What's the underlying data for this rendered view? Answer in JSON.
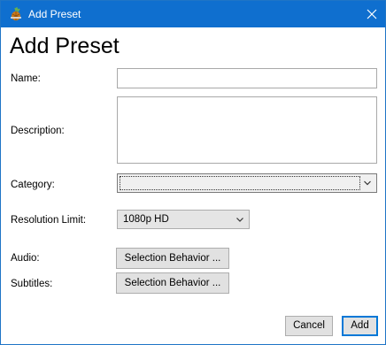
{
  "window": {
    "title": "Add Preset",
    "icons": {
      "app": "handbrake-pineapple-icon",
      "close": "close-icon"
    }
  },
  "form": {
    "heading": "Add Preset",
    "name_label": "Name:",
    "name_value": "",
    "description_label": "Description:",
    "description_value": "",
    "category_label": "Category:",
    "category_value": "",
    "resolution_label": "Resolution Limit:",
    "resolution_value": "1080p HD",
    "audio_label": "Audio:",
    "audio_button": "Selection Behavior ...",
    "subtitles_label": "Subtitles:",
    "subtitles_button": "Selection Behavior ..."
  },
  "footer": {
    "cancel_label": "Cancel",
    "add_label": "Add"
  },
  "colors": {
    "titlebar": "#0f6fcf",
    "default_button_border": "#0078d7"
  }
}
